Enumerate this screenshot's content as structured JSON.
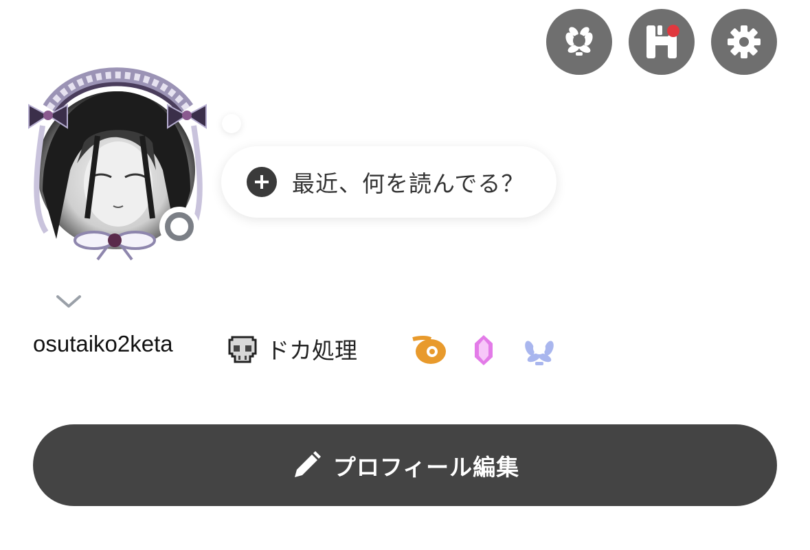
{
  "header": {
    "icons": [
      {
        "name": "laurel-icon",
        "label": ""
      },
      {
        "name": "app-icon",
        "label": ""
      },
      {
        "name": "gear-icon",
        "label": ""
      }
    ],
    "notification_dot_color": "#e0383e"
  },
  "avatar": {
    "status_icon": "status-ring-icon"
  },
  "status_bubble": {
    "plus_icon": "plus-circle-icon",
    "placeholder": "最近、何を読んでる？"
  },
  "profile": {
    "username": "osutaiko2keta",
    "title_icon": "skull-icon",
    "title": "ドカ処理",
    "badges": [
      "orange-badge-icon",
      "pink-gem-icon",
      "blue-laurel-icon"
    ]
  },
  "actions": {
    "edit_icon": "pencil-icon",
    "edit_label": "プロフィール編集"
  },
  "colors": {
    "button_bg": "#444444",
    "top_icon_bg": "#6f6f6f"
  }
}
